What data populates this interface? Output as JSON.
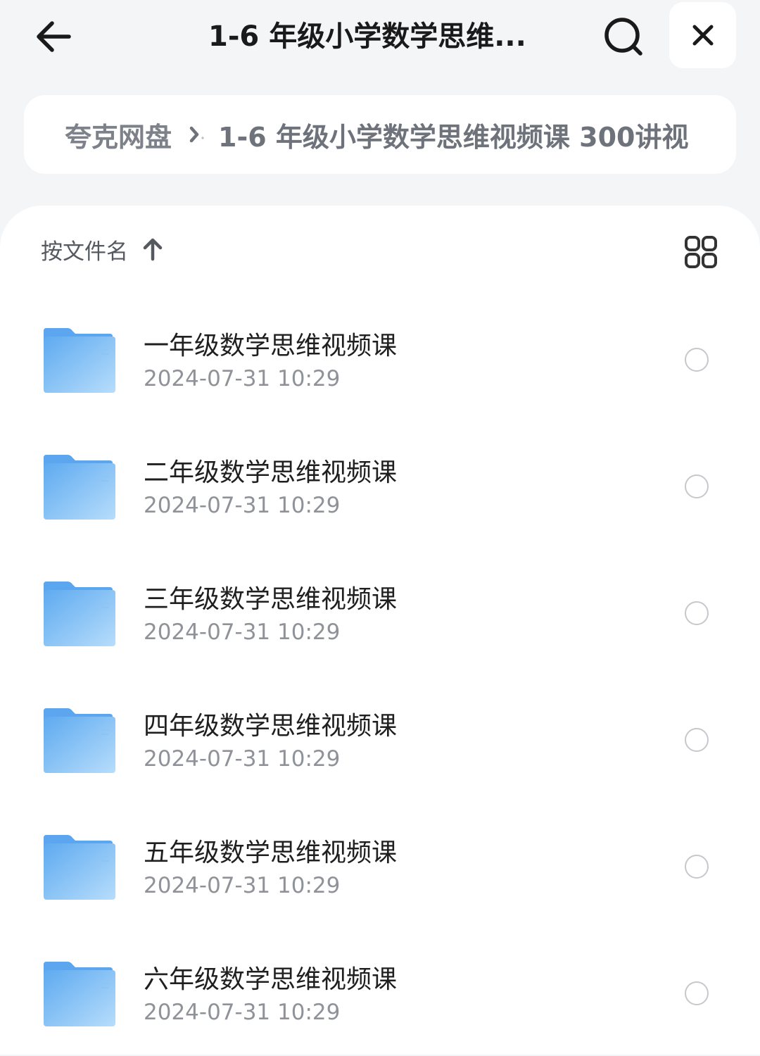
{
  "header": {
    "title": "1-6 年级小学数学思维...",
    "back_icon": "arrow-left-icon",
    "search_icon": "search-icon",
    "close_icon": "close-icon"
  },
  "breadcrumb": {
    "root": "夸克网盘",
    "current": "1-6 年级小学数学思维视频课 300讲视"
  },
  "toolbar": {
    "sort_label": "按文件名",
    "sort_icon": "arrow-up-icon",
    "view_icon": "grid-view-icon"
  },
  "files": [
    {
      "name": "一年级数学思维视频课",
      "date": "2024-07-31 10:29",
      "icon": "folder-icon"
    },
    {
      "name": "二年级数学思维视频课",
      "date": "2024-07-31 10:29",
      "icon": "folder-icon"
    },
    {
      "name": "三年级数学思维视频课",
      "date": "2024-07-31 10:29",
      "icon": "folder-icon"
    },
    {
      "name": "四年级数学思维视频课",
      "date": "2024-07-31 10:29",
      "icon": "folder-icon"
    },
    {
      "name": "五年级数学思维视频课",
      "date": "2024-07-31 10:29",
      "icon": "folder-icon"
    },
    {
      "name": "六年级数学思维视频课",
      "date": "2024-07-31 10:29",
      "icon": "folder-icon"
    }
  ],
  "colors": {
    "background": "#f4f5f7",
    "folder_light": "#9fd0f8",
    "folder_dark": "#5eaaf0",
    "radio_border": "#c6c8cc"
  }
}
